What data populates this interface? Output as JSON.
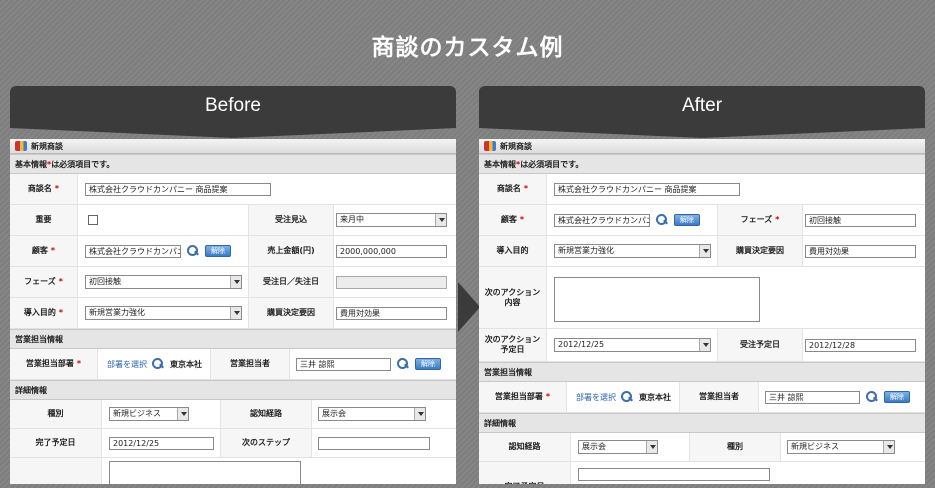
{
  "title": "商談のカスタム例",
  "before_label": "Before",
  "after_label": "After",
  "window_title": "新規商談",
  "basic_info": {
    "prefix": "基本情報 ",
    "star": "*",
    "suffix": "は必須項目です。"
  },
  "search_icon": "search-icon",
  "clear_button": "解除",
  "before": {
    "deal_name_label": "商談名",
    "deal_name_value": "株式会社クラウドカンパニー 商品提案",
    "important_label": "重要",
    "order_forecast_label": "受注見込",
    "order_forecast_value": "来月中",
    "customer_label": "顧客",
    "customer_value": "株式会社クラウドカンパニ",
    "sales_amount_label": "売上金額(円)",
    "sales_amount_value": "2000,000,000",
    "phase_label": "フェーズ",
    "phase_value": "初回接触",
    "order_date_label": "受注日／失注日",
    "purpose_label": "導入目的",
    "purpose_value": "新規営業力強化",
    "purchase_factor_label": "購買決定要因",
    "purchase_factor_value": "費用対効果",
    "sales_section": "営業担当情報",
    "dept_label": "営業担当部署",
    "dept_link": "部署を選択",
    "dept_value": "東京本社",
    "person_label": "営業担当者",
    "person_value": "三井 諒熙",
    "detail_section": "詳細情報",
    "type_label": "種別",
    "type_value": "新規ビジネス",
    "channel_label": "認知経路",
    "channel_value": "展示会",
    "due_label": "完了予定日",
    "due_value": "2012/12/25",
    "next_step_label": "次のステップ"
  },
  "after": {
    "deal_name_label": "商談名",
    "deal_name_value": "株式会社クラウドカンパニー 商品提案",
    "customer_label": "顧客",
    "customer_value": "株式会社クラウドカンパニ",
    "phase_label": "フェーズ",
    "phase_value": "初回接触",
    "purpose_label": "導入目的",
    "purpose_value": "新規営業力強化",
    "purchase_factor_label": "購買決定要因",
    "purchase_factor_value": "費用対効果",
    "next_action_label": "次のアクション内容",
    "next_action_date_label": "次のアクション予定日",
    "next_action_date_value": "2012/12/25",
    "order_due_label": "受注予定日",
    "order_due_value": "2012/12/28",
    "sales_section": "営業担当情報",
    "dept_label": "営業担当部署",
    "dept_link": "部署を選択",
    "dept_value": "東京本社",
    "person_label": "営業担当者",
    "person_value": "三井 諒熙",
    "detail_section": "詳細情報",
    "channel_label": "認知経路",
    "channel_value": "展示会",
    "type_label": "種別",
    "type_value": "新規ビジネス",
    "due_label": "完了予定日"
  }
}
